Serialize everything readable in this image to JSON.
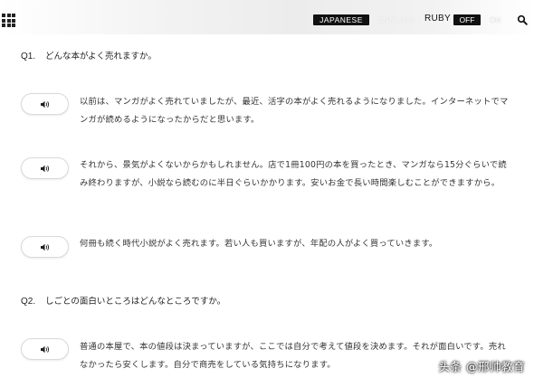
{
  "header": {
    "lang_japanese": "JAPANESE",
    "lang_english": "ENGLISH",
    "ruby_label": "RUBY",
    "ruby_off": "OFF",
    "ruby_on": "ON",
    "menu_icon": "grid-menu-icon",
    "search_icon": "search-icon"
  },
  "qa": [
    {
      "number": "Q1.",
      "question": "どんな本がよく売れますか。",
      "answers": [
        "以前は、マンガがよく売れていましたが、最近、活字の本がよく売れるようになりました。インターネットでマンガが読めるようになったからだと思います。",
        "それから、景気がよくないからかもしれません。店で1冊100円の本を買ったとき、マンガなら15分ぐらいで読み終わりますが、小説なら読むのに半日ぐらいかかります。安いお金で長い時間楽しむことができますから。",
        "何冊も続く時代小説がよく売れます。若い人も買いますが、年配の人がよく買っていきます。"
      ]
    },
    {
      "number": "Q2.",
      "question": "しごとの面白いところはどんなところですか。",
      "answers": [
        "普通の本屋で、本の値段は決まっていますが、ここでは自分で考えて値段を決めます。それが面白いです。売れなかったら安くします。自分で商売をしている気持ちになります。"
      ]
    }
  ],
  "audio_icon": "speaker-icon",
  "watermark": "头条 @邢帅教育",
  "colors": {
    "background": "#ffffff",
    "text": "#333333",
    "active_pill": "#111111"
  }
}
